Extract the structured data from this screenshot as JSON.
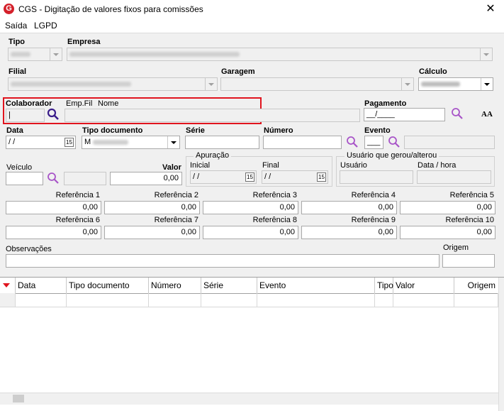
{
  "window": {
    "title": "CGS - Digitação de valores fixos para comissões",
    "icon_letter": "G",
    "close": "✕"
  },
  "menu": {
    "items": [
      "Saída",
      "LGPD"
    ]
  },
  "labels": {
    "tipo": "Tipo",
    "empresa": "Empresa",
    "filial": "Filial",
    "garagem": "Garagem",
    "calculo": "Cálculo",
    "colaborador": "Colaborador",
    "empfil": "Emp.Fil",
    "nome": "Nome",
    "pagamento": "Pagamento",
    "data": "Data",
    "tipo_documento": "Tipo documento",
    "serie": "Série",
    "numero": "Número",
    "evento": "Evento",
    "veiculo": "Veículo",
    "valor": "Valor",
    "apuracao": "Apuração",
    "inicial": "Inicial",
    "final": "Final",
    "usuario_group": "Usuário que gerou/alterou",
    "usuario": "Usuário",
    "data_hora": "Data / hora",
    "observacoes": "Observações",
    "origem": "Origem",
    "font_size": "AA"
  },
  "values": {
    "pagamento": "__/____",
    "data": "/  /",
    "inicial": "/  /",
    "final": "/  /",
    "valor": "0,00",
    "tipo_documento_first": "M",
    "calendar_day": "15"
  },
  "references": [
    {
      "label": "Referência 1",
      "value": "0,00"
    },
    {
      "label": "Referência 2",
      "value": "0,00"
    },
    {
      "label": "Referência 3",
      "value": "0,00"
    },
    {
      "label": "Referência 4",
      "value": "0,00"
    },
    {
      "label": "Referência 5",
      "value": "0,00"
    },
    {
      "label": "Referência 6",
      "value": "0,00"
    },
    {
      "label": "Referência 7",
      "value": "0,00"
    },
    {
      "label": "Referência 8",
      "value": "0,00"
    },
    {
      "label": "Referência 9",
      "value": "0,00"
    },
    {
      "label": "Referência 10",
      "value": "0,00"
    }
  ],
  "grid": {
    "columns": [
      "Data",
      "Tipo documento",
      "Número",
      "Série",
      "Evento",
      "Tipo",
      "Valor",
      "Origem"
    ]
  },
  "colors": {
    "accent_red": "#e0141e",
    "lens": "#8b1fa8",
    "brand_red": "#d4202a"
  },
  "icons": [
    "search-icon",
    "calendar-icon",
    "font-size-icon",
    "dropdown-arrow-icon",
    "close-icon",
    "sort-arrow-icon"
  ]
}
